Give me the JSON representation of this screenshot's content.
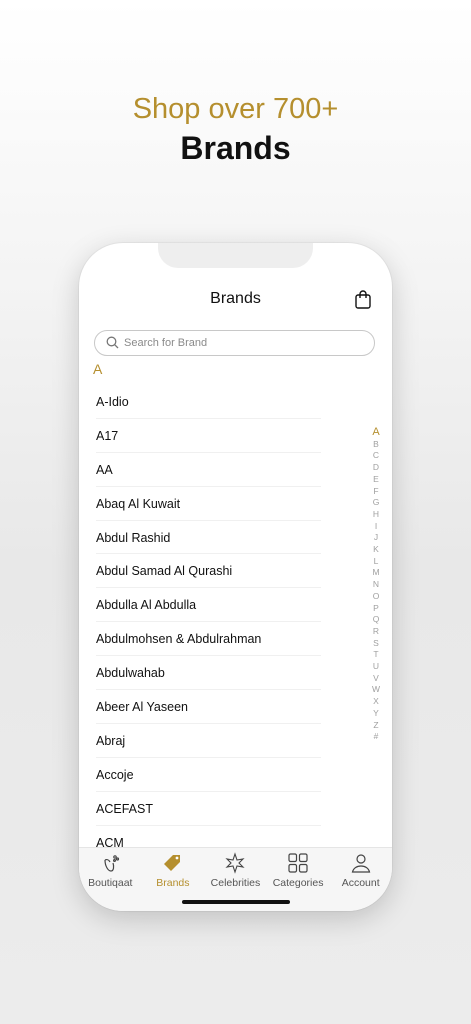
{
  "headline": {
    "line1": "Shop over 700+",
    "line2": "Brands"
  },
  "app": {
    "title": "Brands",
    "search": {
      "placeholder": "Search for Brand",
      "value": ""
    },
    "section_letter": "A",
    "brands": [
      "A-Idio",
      "A17",
      "AA",
      "Abaq Al Kuwait",
      "Abdul Rashid",
      "Abdul Samad Al Qurashi",
      "Abdulla Al Abdulla",
      "Abdulmohsen & Abdulrahman",
      "Abdulwahab",
      "Abeer Al Yaseen",
      "Abraj",
      "Accoje",
      "ACEFAST",
      "ACM"
    ],
    "index_letters": [
      "A",
      "B",
      "C",
      "D",
      "E",
      "F",
      "G",
      "H",
      "I",
      "J",
      "K",
      "L",
      "M",
      "N",
      "O",
      "P",
      "Q",
      "R",
      "S",
      "T",
      "U",
      "V",
      "W",
      "X",
      "Y",
      "Z",
      "#"
    ],
    "tabs": [
      {
        "label": "Boutiqaat",
        "icon": "boutiqaat-logo-icon",
        "active": false
      },
      {
        "label": "Brands",
        "icon": "tag-icon",
        "active": true
      },
      {
        "label": "Celebrities",
        "icon": "star-flower-icon",
        "active": false
      },
      {
        "label": "Categories",
        "icon": "grid-icon",
        "active": false
      },
      {
        "label": "Account",
        "icon": "person-icon",
        "active": false
      }
    ]
  },
  "colors": {
    "accent": "#b58f2e",
    "text": "#111111",
    "muted": "#a0a0a0"
  }
}
